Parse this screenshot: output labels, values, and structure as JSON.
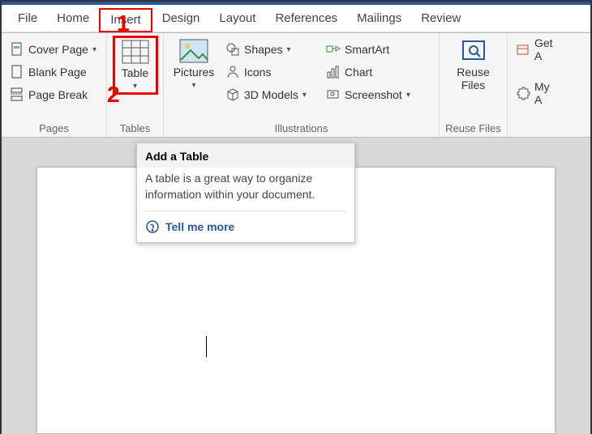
{
  "annotations": {
    "step1": "1",
    "step2": "2"
  },
  "tabs": {
    "file": "File",
    "home": "Home",
    "insert": "Insert",
    "design": "Design",
    "layout": "Layout",
    "references": "References",
    "mailings": "Mailings",
    "review": "Review"
  },
  "groups": {
    "pages": {
      "label": "Pages",
      "cover_page": "Cover Page",
      "blank_page": "Blank Page",
      "page_break": "Page Break"
    },
    "tables": {
      "label": "Tables",
      "table": "Table"
    },
    "illustrations": {
      "label": "Illustrations",
      "pictures": "Pictures",
      "shapes": "Shapes",
      "icons": "Icons",
      "models": "3D Models",
      "smartart": "SmartArt",
      "chart": "Chart",
      "screenshot": "Screenshot"
    },
    "reuse": {
      "label": "Reuse Files",
      "reuse_files": "Reuse\nFiles"
    },
    "addins": {
      "get": "Get Addins",
      "my": "My Addins"
    }
  },
  "tooltip": {
    "title": "Add a Table",
    "body": "A table is a great way to organize information within your document.",
    "link": "Tell me more"
  }
}
